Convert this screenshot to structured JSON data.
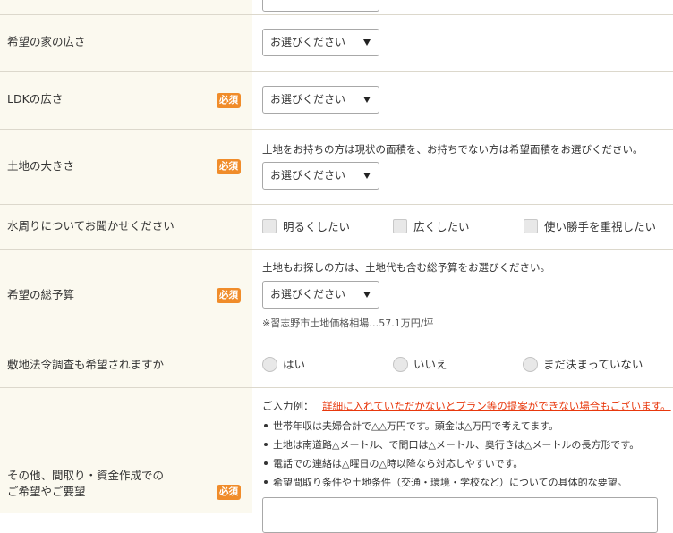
{
  "form": {
    "select_default": "お選びください",
    "required_label": "必須",
    "house_size": {
      "label": "希望の家の広さ"
    },
    "ldk_size": {
      "label": "LDKの広さ"
    },
    "land_size": {
      "label": "土地の大きさ",
      "note": "土地をお持ちの方は現状の面積を、お持ちでない方は希望面積をお選びください。"
    },
    "water": {
      "label": "水周りについてお聞かせください",
      "options": [
        "明るくしたい",
        "広くしたい",
        "使い勝手を重視したい"
      ]
    },
    "budget": {
      "label": "希望の総予算",
      "note": "土地もお探しの方は、土地代も含む総予算をお選びください。",
      "subnote": "※習志野市土地価格相場…57.1万円/坪"
    },
    "survey": {
      "label": "敷地法令調査も希望されますか",
      "options": [
        "はい",
        "いいえ",
        "まだ決まっていない"
      ]
    },
    "other": {
      "label_line1": "その他、間取り・資金作成での",
      "label_line2": "ご希望やご要望",
      "example_label": "ご入力例：",
      "example_warning": "詳細に入れていただかないとプラン等の提案ができない場合もございます。",
      "examples": [
        "世帯年収は夫婦合計で△△万円です。頭金は△万円で考えてます。",
        "土地は南道路△メートル、で間口は△メートル、奥行きは△メートルの長方形です。",
        "電話での連絡は△曜日の△時以降なら対応しやすいです。",
        "希望間取り条件や土地条件（交通・環境・学校など）についての具体的な要望。"
      ]
    }
  }
}
